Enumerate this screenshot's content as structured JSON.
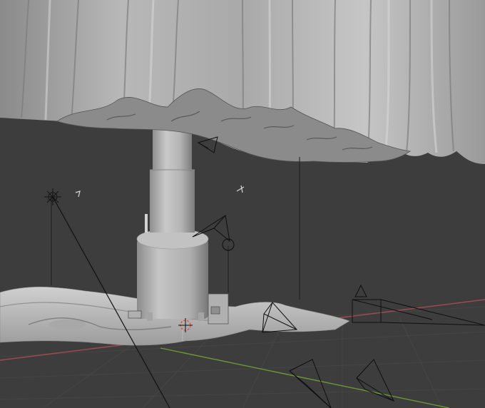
{
  "viewport": {
    "background_color": "#3d3d3d",
    "grid_color": "#444444",
    "axis_x_color": "#9b4b53",
    "axis_y_color": "#6a9a32",
    "mesh_color": "#bdbdbd",
    "wire_color": "#111111",
    "origin_marker_color": "#e8503c",
    "objects": [
      "curtain-cloth-mesh",
      "column-tower-mesh",
      "tank-mesh",
      "terrain-mesh",
      "camera-object",
      "light-object",
      "empty-object"
    ]
  }
}
